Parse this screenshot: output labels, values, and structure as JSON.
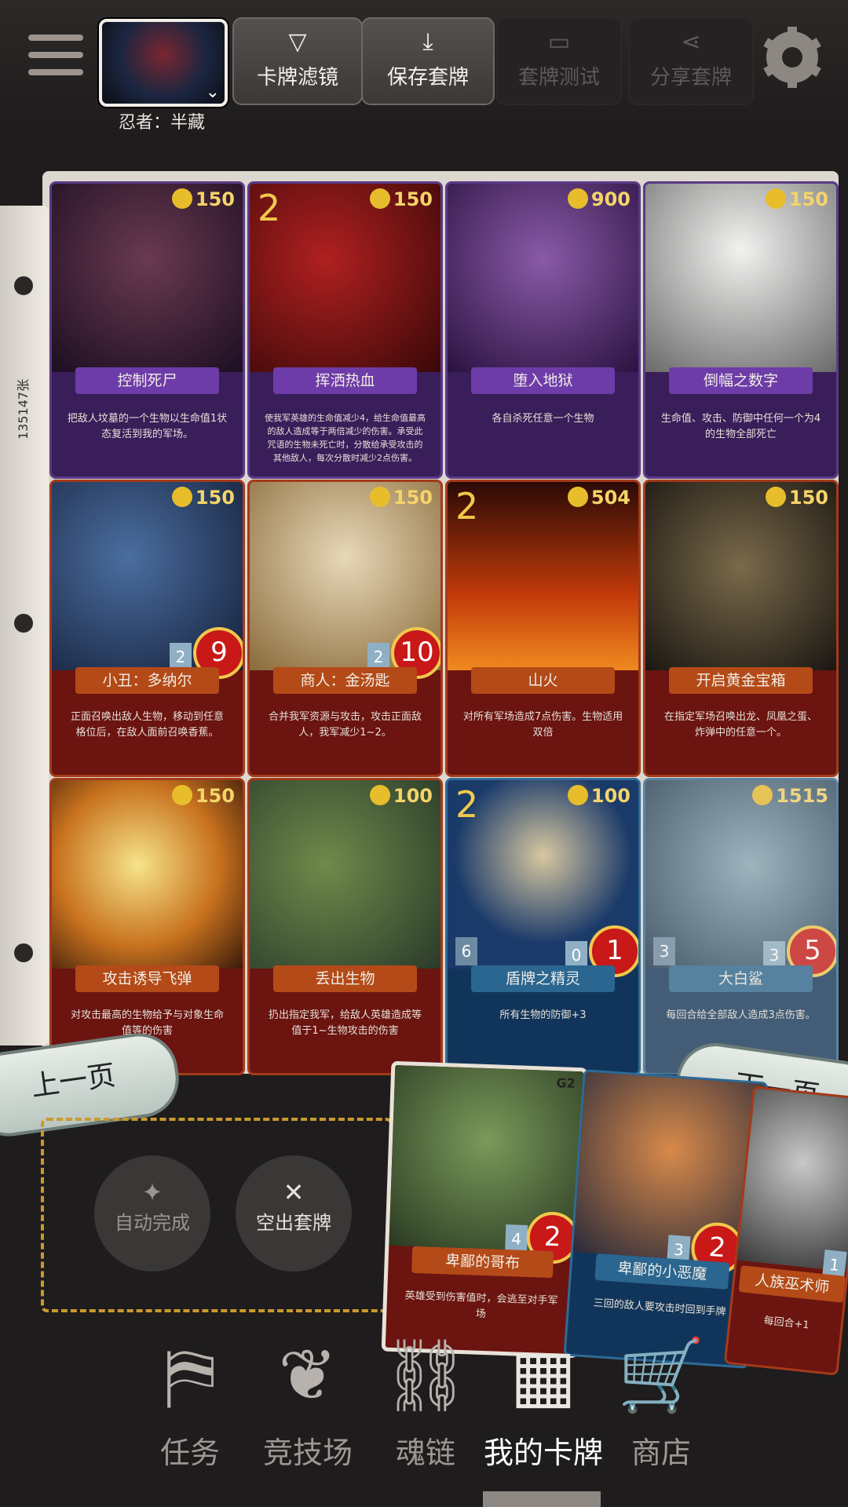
{
  "header": {
    "hero_name": "忍者：半藏",
    "buttons": [
      {
        "label": "卡牌滤镜",
        "icon": "filter-icon",
        "enabled": true
      },
      {
        "label": "保存套牌",
        "icon": "download-icon",
        "enabled": true
      },
      {
        "label": "套牌测试",
        "icon": "cards-icon",
        "enabled": false
      },
      {
        "label": "分享套牌",
        "icon": "share-icon",
        "enabled": false
      }
    ]
  },
  "collection_count": "135147张",
  "cards": [
    {
      "name": "控制死尸",
      "cost": "150",
      "desc": "把敌人坟墓的一个生物以生命值1状态复活到我的军场。",
      "theme": "purple",
      "big": ""
    },
    {
      "name": "挥洒热血",
      "cost": "150",
      "desc": "使我军英雄的生命值减少4，给生命值最高的敌人造成等于两倍减少的伤害。承受此咒语的生物未死亡时，分散给承受攻击的其他敌人，每次分散时减少2点伤害。",
      "theme": "purple",
      "big": "2"
    },
    {
      "name": "堕入地狱",
      "cost": "900",
      "desc": "各自杀死任意一个生物",
      "theme": "purple",
      "big": ""
    },
    {
      "name": "倒幅之数字",
      "cost": "150",
      "desc": "生命值、攻击、防御中任何一个为4的生物全部死亡",
      "theme": "purple",
      "big": ""
    },
    {
      "name": "小丑：多纳尔",
      "cost": "150",
      "desc": "正面召唤出敌人生物，移动到任意格位后，在敌人面前召唤香蕉。",
      "theme": "red",
      "big": "",
      "power": "9",
      "armor": "2"
    },
    {
      "name": "商人：金汤匙",
      "cost": "150",
      "desc": "合并我军资源与攻击，攻击正面敌人，我军减少1~2。",
      "theme": "red",
      "big": "",
      "power": "10",
      "armor": "2"
    },
    {
      "name": "山火",
      "cost": "504",
      "desc": "对所有军场造成7点伤害。生物适用双倍",
      "theme": "red",
      "big": "2"
    },
    {
      "name": "开启黄金宝箱",
      "cost": "150",
      "desc": "在指定军场召唤出龙、凤凰之蛋、炸弹中的任意一个。",
      "theme": "red",
      "big": ""
    },
    {
      "name": "攻击诱导飞弹",
      "cost": "150",
      "desc": "对攻击最高的生物给予与对象生命值等的伤害",
      "theme": "red",
      "big": ""
    },
    {
      "name": "丢出生物",
      "cost": "100",
      "desc": "扔出指定我军，给敌人英雄造成等值于1~生物攻击的伤害",
      "theme": "red",
      "big": ""
    },
    {
      "name": "盾牌之精灵",
      "cost": "100",
      "desc": "所有生物的防御+3",
      "theme": "blue",
      "big": "2",
      "power": "1",
      "armor": "0",
      "shield": "6"
    },
    {
      "name": "大白鲨",
      "cost": "1515",
      "desc": "每回合给全部敌人造成3点伤害。",
      "theme": "blue",
      "big": "",
      "power": "5",
      "armor": "3",
      "shield": "3"
    }
  ],
  "paging": {
    "prev": "上一页",
    "next": "下一页"
  },
  "tray": {
    "auto": "自动完成",
    "clear": "空出套牌"
  },
  "hand": [
    {
      "name": "卑鄙的哥布",
      "desc": "英雄受到伤害值时，会逃至对手军场",
      "power": "2",
      "armor": "4",
      "tag": "G2"
    },
    {
      "name": "卑鄙的小恶魔",
      "desc": "三回的敌人要攻击时回到手牌",
      "power": "2",
      "armor": "3"
    },
    {
      "name": "人族巫术师",
      "desc": "每回合+1",
      "armor": "1"
    }
  ],
  "nav": [
    {
      "label": "任务",
      "icon": "scroll-icon"
    },
    {
      "label": "竞技场",
      "icon": "dragon-icon"
    },
    {
      "label": "魂链",
      "icon": "chain-icon"
    },
    {
      "label": "我的卡牌",
      "icon": "binder-icon",
      "active": true
    },
    {
      "label": "商店",
      "icon": "cart-icon"
    }
  ]
}
